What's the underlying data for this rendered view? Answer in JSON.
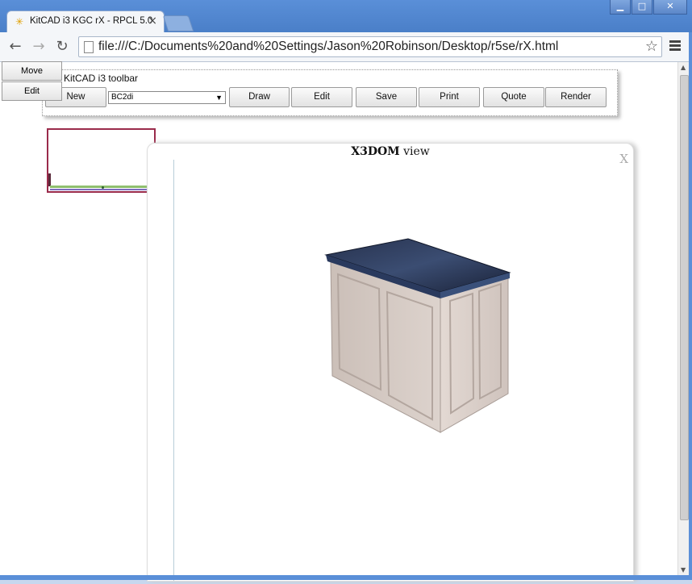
{
  "browser": {
    "tab_title": "KitCAD i3 KGC rX - RPCL 5.0",
    "tab_close": "×",
    "url": "file:///C:/Documents%20and%20Settings/Jason%20Robinson/Desktop/r5se/rX.html",
    "nav": {
      "back": "←",
      "forward": "→",
      "reload": "↻"
    },
    "window_buttons": {
      "minimize": "▁",
      "maximize": "□",
      "close": "✕"
    }
  },
  "context_menu": {
    "items": [
      "Move",
      "Edit"
    ]
  },
  "kitcad_toolbar": {
    "title": "KitCAD i3 toolbar",
    "new_label": "New",
    "select_value": "BC2di",
    "buttons": {
      "draw": "Draw",
      "edit": "Edit",
      "save": "Save",
      "print": "Print",
      "quote": "Quote",
      "render": "Render"
    }
  },
  "x3dom_dialog": {
    "title_bold": "X3DOM",
    "title_rest": " view",
    "close_label": "X"
  },
  "colors": {
    "titlebar": "#5a8fd8",
    "plan_border": "#9a2b4b",
    "countertop": "#1f2a44",
    "cabinet_body": "#d8cdc6"
  }
}
